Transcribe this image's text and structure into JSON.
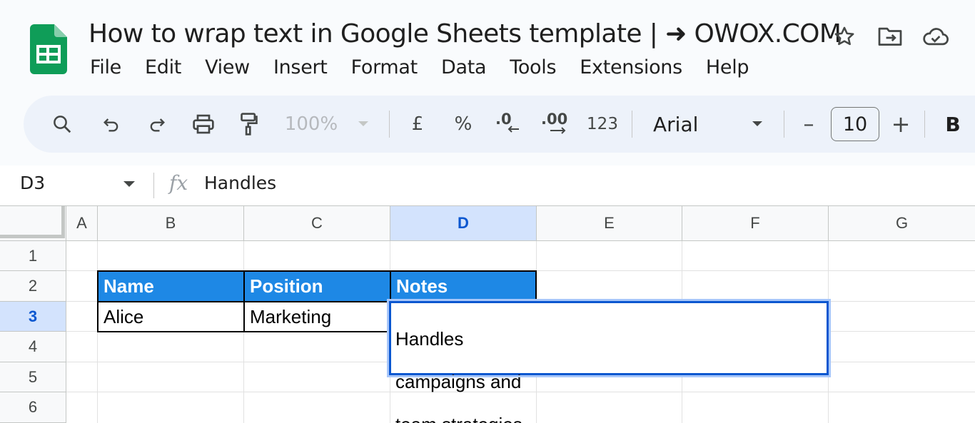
{
  "app": {
    "name": "Google Sheets",
    "logo_icon": "sheets-logo-icon",
    "brand_color": "#0f9d58"
  },
  "document": {
    "title": "How to wrap text in Google Sheets template | ➜ OWOX.COM",
    "actions": [
      "star-icon",
      "move-to-folder-icon",
      "cloud-status-icon"
    ]
  },
  "menu": [
    "File",
    "Edit",
    "View",
    "Insert",
    "Format",
    "Data",
    "Tools",
    "Extensions",
    "Help"
  ],
  "toolbar": {
    "zoom": "100%",
    "currency": "£",
    "percent": "%",
    "decrease_decimals": ".0",
    "increase_decimals": ".00",
    "number_format": "123",
    "font": "Arial",
    "font_size": "10",
    "font_size_minus": "–",
    "font_size_plus": "+",
    "bold": "B"
  },
  "formula_bar": {
    "name_box": "D3",
    "fx": "fx",
    "formula": "Handles"
  },
  "grid": {
    "columns": [
      "A",
      "B",
      "C",
      "D",
      "E",
      "F",
      "G"
    ],
    "active_column": "D",
    "rows": [
      "1",
      "2",
      "3",
      "4",
      "5",
      "6"
    ],
    "active_row": "3",
    "table": {
      "headers": [
        "Name",
        "Position",
        "Notes"
      ],
      "row": [
        "Alice",
        "Marketing"
      ],
      "header_color": "#1e88e5"
    },
    "active_cell": {
      "ref": "D3",
      "lines": [
        "Handles",
        "campaigns and",
        "team strategies."
      ]
    }
  }
}
